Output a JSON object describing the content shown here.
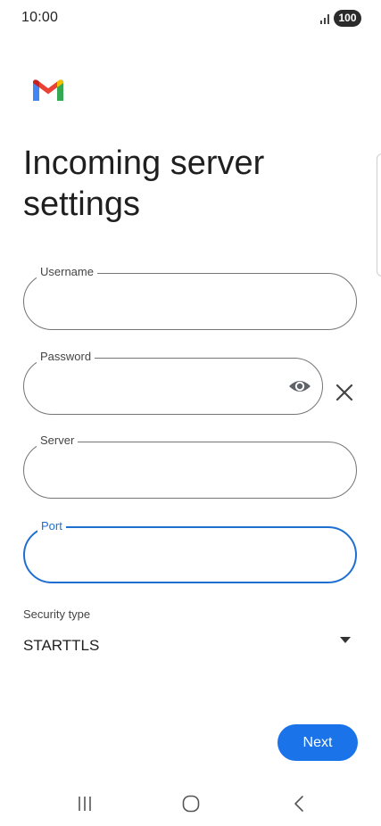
{
  "status_bar": {
    "time": "10:00",
    "battery": "100",
    "icons": [
      "signal-icon",
      "battery-icon"
    ]
  },
  "app": {
    "logo_icon": "gmail-logo-icon",
    "title": "Incoming server settings"
  },
  "form": {
    "username": {
      "label": "Username",
      "value": ""
    },
    "password": {
      "label": "Password",
      "value": "",
      "icons": [
        "eye-icon",
        "close-icon"
      ]
    },
    "server": {
      "label": "Server",
      "value": ""
    },
    "port": {
      "label": "Port",
      "value": "",
      "focused": true
    },
    "security": {
      "label": "Security type",
      "value": "STARTTLS",
      "icon": "dropdown-arrow-icon"
    }
  },
  "actions": {
    "next_label": "Next"
  },
  "nav_bar": {
    "icons": [
      "recent-apps-icon",
      "home-icon",
      "back-icon"
    ]
  },
  "colors": {
    "accent": "#1a73e8",
    "focus_border": "#1f6fd1",
    "field_border": "#757575",
    "text": "#1f1f1f"
  }
}
